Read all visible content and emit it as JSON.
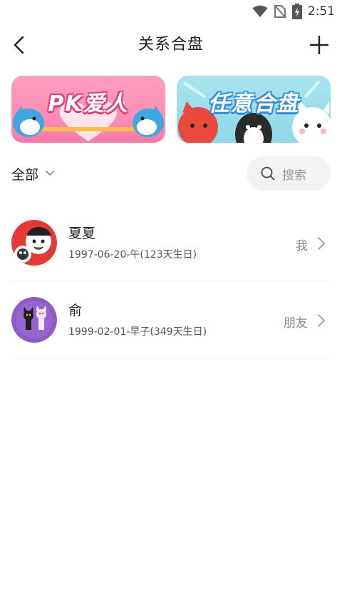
{
  "status_bar": {
    "time": "2:51",
    "icons": [
      "wifi-icon",
      "no-sim-icon",
      "battery-charging-icon"
    ]
  },
  "header": {
    "title": "关系合盘",
    "back_icon": "back-arrow-icon",
    "add_icon": "plus-icon"
  },
  "banners": [
    {
      "title": "PK爱人",
      "color": "#ff8db5"
    },
    {
      "title": "任意合盘",
      "color": "#8fd8e8"
    }
  ],
  "filter": {
    "label": "全部",
    "dropdown_icon": "chevron-down-icon"
  },
  "search": {
    "placeholder": "搜索",
    "icon": "search-icon"
  },
  "contacts": [
    {
      "name": "夏夏",
      "subtitle": "1997-06-20-午(123天生日)",
      "tag": "我",
      "avatar_color": "#e53935"
    },
    {
      "name": "俞",
      "subtitle": "1999-02-01-早子(349天生日)",
      "tag": "朋友",
      "avatar_color": "#8e5cc7"
    }
  ]
}
